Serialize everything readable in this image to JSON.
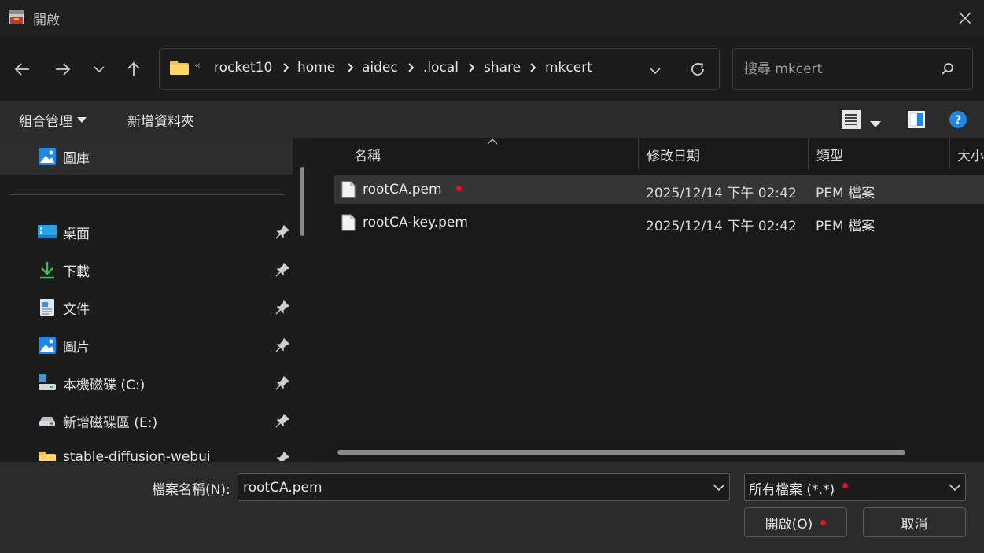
{
  "window": {
    "title": "開啟"
  },
  "address": {
    "overflow_glyph": "«",
    "crumbs": [
      "rocket10",
      "home",
      "aidec",
      ".local",
      "share",
      "mkcert"
    ]
  },
  "search": {
    "placeholder": "搜尋 mkcert"
  },
  "commandbar": {
    "organize_label": "組合管理",
    "new_folder_label": "新增資料夾"
  },
  "sidebar": {
    "gallery_label": "圖庫",
    "items": [
      {
        "label": "桌面",
        "icon": "desktop-icon"
      },
      {
        "label": "下載",
        "icon": "download-icon"
      },
      {
        "label": "文件",
        "icon": "documents-icon"
      },
      {
        "label": "圖片",
        "icon": "pictures-icon"
      },
      {
        "label": "本機磁碟 (C:)",
        "icon": "drive-c-icon"
      },
      {
        "label": "新增磁碟區 (E:)",
        "icon": "drive-e-icon"
      },
      {
        "label": "stable-diffusion-webui",
        "icon": "folder-icon"
      }
    ]
  },
  "columns": {
    "name": "名稱",
    "modified": "修改日期",
    "type": "類型",
    "size": "大小"
  },
  "files": [
    {
      "name": "rootCA.pem",
      "modified": "2025/12/14 下午 02:42",
      "type": "PEM 檔案",
      "selected": true
    },
    {
      "name": "rootCA-key.pem",
      "modified": "2025/12/14 下午 02:42",
      "type": "PEM 檔案",
      "selected": false
    }
  ],
  "bottom": {
    "filename_label": "檔案名稱(N):",
    "filename_value": "rootCA.pem",
    "filter_value": "所有檔案 (*.*)",
    "open_label": "開啟(O)",
    "cancel_label": "取消"
  },
  "colors": {
    "accent_dot": "#e81123",
    "folder": "#f2c14e",
    "help": "#1e88e5"
  }
}
